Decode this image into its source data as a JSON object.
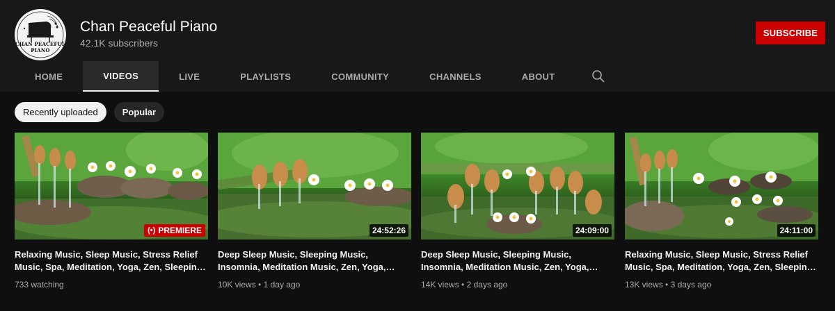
{
  "channel": {
    "name": "Chan Peaceful Piano",
    "subscribers": "42.1K subscribers",
    "avatar_text": [
      "CHAN PEACEFUL",
      "PIANO"
    ],
    "subscribe_label": "SUBSCRIBE",
    "subscribe_color": "#cc0000"
  },
  "tabs": [
    {
      "label": "HOME",
      "active": false
    },
    {
      "label": "VIDEOS",
      "active": true
    },
    {
      "label": "LIVE",
      "active": false
    },
    {
      "label": "PLAYLISTS",
      "active": false
    },
    {
      "label": "COMMUNITY",
      "active": false
    },
    {
      "label": "CHANNELS",
      "active": false
    },
    {
      "label": "ABOUT",
      "active": false
    }
  ],
  "search_icon": "search-icon",
  "chips": [
    {
      "label": "Recently uploaded",
      "selected": true
    },
    {
      "label": "Popular",
      "selected": false
    }
  ],
  "videos": [
    {
      "title": "Relaxing Music, Sleep Music, Stress Relief Music, Spa, Meditation, Yoga, Zen, Sleepin…",
      "badge": "PREMIERE",
      "badge_type": "premiere",
      "views": "733 watching",
      "age": ""
    },
    {
      "title": "Deep Sleep Music, Sleeping Music, Insomnia, Meditation Music, Zen, Yoga,…",
      "badge": "24:52:26",
      "badge_type": "duration",
      "views": "10K views",
      "age": "1 day ago"
    },
    {
      "title": "Deep Sleep Music, Sleeping Music, Insomnia, Meditation Music, Zen, Yoga,…",
      "badge": "24:09:00",
      "badge_type": "duration",
      "views": "14K views",
      "age": "2 days ago"
    },
    {
      "title": "Relaxing Music, Sleep Music, Stress Relief Music, Spa, Meditation, Yoga, Zen, Sleepin…",
      "badge": "24:11:00",
      "badge_type": "duration",
      "views": "13K views",
      "age": "3 days ago"
    }
  ]
}
